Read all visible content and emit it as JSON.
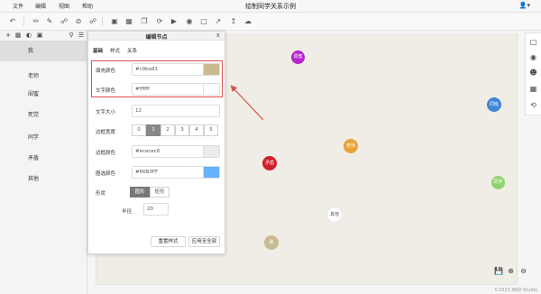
{
  "menubar": {
    "items": [
      "文件",
      "编辑",
      "视图",
      "帮助"
    ],
    "title": "绘制同学关系示例",
    "user_icon": "user-icon"
  },
  "toolbar": {
    "icons": [
      "undo-icon",
      "comment-icon",
      "comment-off-icon",
      "link-icon",
      "unlink-icon",
      "ban-icon",
      "link-alt-icon",
      "image-icon",
      "table-icon",
      "copy-icon",
      "refresh-icon",
      "play-icon",
      "video-icon",
      "layout-icon",
      "export-icon",
      "upload-icon",
      "cloud-icon"
    ]
  },
  "sidebar": {
    "items": [
      {
        "label": "我",
        "selected": true
      },
      {
        "label": "老师"
      },
      {
        "label": "闺蜜"
      },
      {
        "label": "死党"
      },
      {
        "label": "同学"
      },
      {
        "label": "矛盾"
      },
      {
        "label": "其他"
      }
    ]
  },
  "dialog": {
    "title": "编辑节点",
    "close": "x",
    "tabs": [
      "基础",
      "样式",
      "关系"
    ],
    "fill_color": {
      "label": "填充颜色",
      "value": "#c9ba91",
      "swatch": "#c9ba91"
    },
    "text_color": {
      "label": "文字颜色",
      "value": "#ffffff",
      "swatch": "#ffffff"
    },
    "font_size": {
      "label": "文字大小",
      "value": "12"
    },
    "border_width": {
      "label": "边框宽度",
      "options": [
        "0",
        "1",
        "2",
        "3",
        "4",
        "5"
      ],
      "selected": "1"
    },
    "border_color": {
      "label": "边框颜色",
      "value": "#ececec6",
      "swatch": "#ececec"
    },
    "circle_color": {
      "label": "圈选颜色",
      "value": "#66B3FF",
      "swatch": "#66B3FF"
    },
    "shape": {
      "label": "形状",
      "options": [
        "圆形",
        "矩形"
      ],
      "selected": "圆形"
    },
    "radius": {
      "label": "半径",
      "value": "20"
    },
    "reset_label": "重置样式",
    "apply_all_label": "应用至全部"
  },
  "nodes": [
    {
      "label": "闺蜜",
      "color": "#b524cc"
    },
    {
      "label": "同班",
      "color": "#3d87d8"
    },
    {
      "label": "老师",
      "color": "#e8a23a"
    },
    {
      "label": "矛盾",
      "color": "#d11e2c"
    },
    {
      "label": "同学",
      "color": "#8ed36e"
    },
    {
      "label": "其他",
      "color": "#ffffff"
    },
    {
      "label": "我",
      "color": "#c9ba91"
    }
  ],
  "footer": "©2023 NRD Studio"
}
